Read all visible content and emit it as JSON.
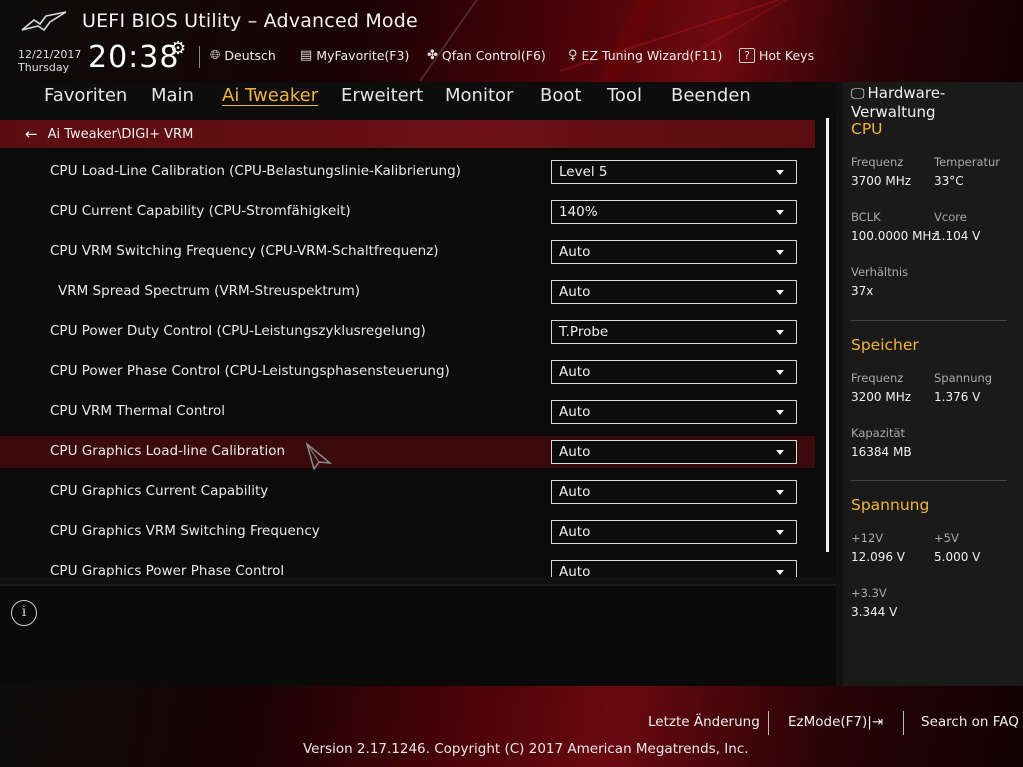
{
  "header": {
    "title": "UEFI BIOS Utility – Advanced Mode",
    "date": "12/21/2017",
    "weekday": "Thursday",
    "time": "20:38",
    "language_label": "Deutsch",
    "myfavorite_label": "MyFavorite(F3)",
    "qfan_label": "Qfan Control(F6)",
    "ez_tuning_label": "EZ Tuning Wizard(F11)",
    "hotkeys_label": "Hot Keys",
    "hotkeys_icon_text": "?"
  },
  "menu": {
    "items": [
      "Favoriten",
      "Main",
      "Ai Tweaker",
      "Erweitert",
      "Monitor",
      "Boot",
      "Tool",
      "Beenden"
    ],
    "active": "Ai Tweaker"
  },
  "breadcrumb": "Ai Tweaker\\DIGI+ VRM",
  "settings": [
    {
      "label": "CPU Load-Line Calibration (CPU-Belastungslinie-Kalibrierung)",
      "value": "Level 5"
    },
    {
      "label": "CPU Current Capability (CPU-Stromfähigkeit)",
      "value": "140%"
    },
    {
      "label": "CPU VRM Switching Frequency (CPU-VRM-Schaltfrequenz)",
      "value": "Auto"
    },
    {
      "label": "VRM Spread Spectrum (VRM-Streuspektrum)",
      "value": "Auto"
    },
    {
      "label": "CPU Power Duty Control (CPU-Leistungszyklusregelung)",
      "value": "T.Probe"
    },
    {
      "label": "CPU Power Phase Control (CPU-Leistungsphasensteuerung)",
      "value": "Auto"
    },
    {
      "label": "CPU VRM Thermal Control",
      "value": "Auto"
    },
    {
      "label": "CPU Graphics Load-line Calibration",
      "value": "Auto"
    },
    {
      "label": "CPU Graphics Current Capability",
      "value": "Auto"
    },
    {
      "label": "CPU Graphics VRM Switching Frequency",
      "value": "Auto"
    },
    {
      "label": "CPU Graphics Power Phase Control",
      "value": "Auto"
    }
  ],
  "info_icon_text": "i",
  "hardware": {
    "title": "Hardware-Verwaltung",
    "cpu": {
      "section": "CPU",
      "freq_key": "Frequenz",
      "freq_val": "3700 MHz",
      "temp_key": "Temperatur",
      "temp_val": "33°C",
      "bclk_key": "BCLK",
      "bclk_val": "100.0000 MHz",
      "vcore_key": "Vcore",
      "vcore_val": "1.104 V",
      "ratio_key": "Verhältnis",
      "ratio_val": "37x"
    },
    "memory": {
      "section": "Speicher",
      "freq_key": "Frequenz",
      "freq_val": "3200 MHz",
      "volt_key": "Spannung",
      "volt_val": "1.376 V",
      "cap_key": "Kapazität",
      "cap_val": "16384 MB"
    },
    "voltage": {
      "section": "Spannung",
      "v12_key": "+12V",
      "v12_val": "12.096 V",
      "v5_key": "+5V",
      "v5_val": "5.000 V",
      "v33_key": "+3.3V",
      "v33_val": "3.344 V"
    }
  },
  "footer": {
    "last_change": "Letzte Änderung",
    "ezmode": "EzMode(F7)|",
    "search_faq": "Search on FAQ",
    "copyright": "Version 2.17.1246. Copyright (C) 2017 American Megatrends, Inc."
  },
  "colors": {
    "accent": "#f2b53b",
    "breadcrumb_bg": "#5a0d10",
    "selected_row": "#3a0a0d"
  }
}
